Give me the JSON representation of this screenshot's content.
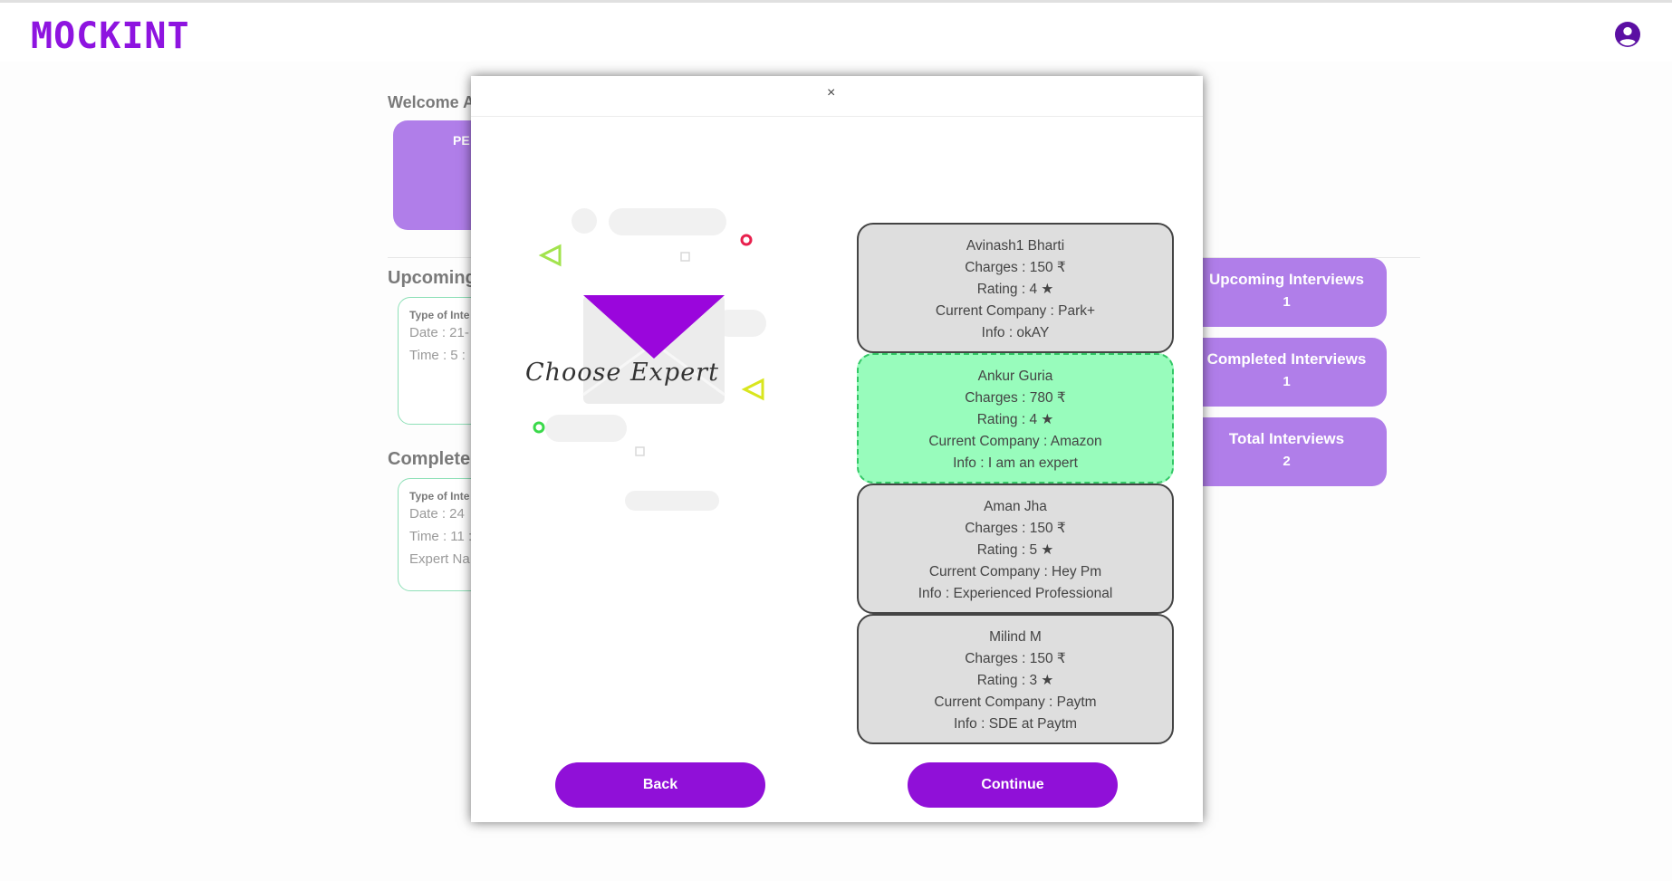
{
  "app": {
    "logo": "MOCKINT"
  },
  "background": {
    "welcome": "Welcome A",
    "profile_label": "PE",
    "upcoming_heading": "Upcoming",
    "completed_heading": "Complete",
    "upcoming_card": [
      "Type of Inte",
      "Date : 21-",
      "Time : 5 :"
    ],
    "completed_card": [
      "Type of Inte",
      "Date : 24",
      "Time : 11 :",
      "Expert Na"
    ],
    "stats": [
      {
        "label": "Upcoming Interviews",
        "value": "1"
      },
      {
        "label": "Completed Interviews",
        "value": "1"
      },
      {
        "label": "Total Interviews",
        "value": "2"
      }
    ]
  },
  "modal": {
    "close_symbol": "×",
    "illustration_text": "Choose Expert",
    "experts": [
      {
        "name": "Avinash1 Bharti",
        "charges": "Charges : 150 ₹",
        "rating": "Rating : 4 ★",
        "company": "Current Company : Park+",
        "info": "Info : okAY"
      },
      {
        "name": "Ankur Guria",
        "charges": "Charges : 780 ₹",
        "rating": "Rating : 4 ★",
        "company": "Current Company : Amazon",
        "info": "Info : I am an expert"
      },
      {
        "name": "Aman Jha",
        "charges": "Charges : 150 ₹",
        "rating": "Rating : 5 ★",
        "company": "Current Company : Hey Pm",
        "info": "Info : Experienced Professional"
      },
      {
        "name": "Milind M",
        "charges": "Charges : 150 ₹",
        "rating": "Rating : 3 ★",
        "company": "Current Company : Paytm",
        "info": "Info : SDE at Paytm"
      }
    ],
    "selected_expert_index": 1,
    "back_label": "Back",
    "continue_label": "Continue"
  },
  "colors": {
    "brand": "#8e14e0",
    "button": "#9010d8",
    "selected_card": "#98fcbc",
    "card": "#dedede",
    "stat_card": "#b07ee9"
  },
  "icons": {
    "account": "account-circle-icon"
  }
}
